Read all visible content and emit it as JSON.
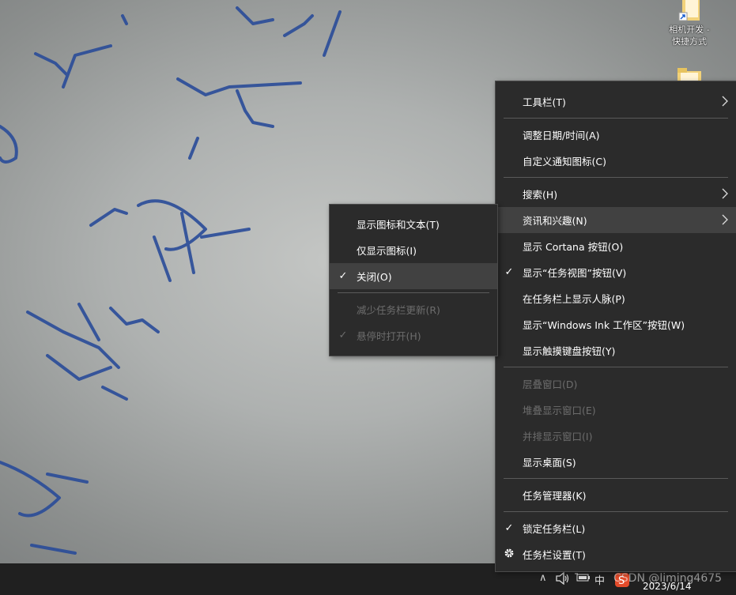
{
  "desktop": {
    "icons": [
      {
        "label_line1": "相机开发 -",
        "label_line2": "快捷方式",
        "icon": "folder-shortcut-icon"
      },
      {
        "label_line1": "",
        "label_line2": "",
        "icon": "folder-icon"
      }
    ]
  },
  "main_menu": {
    "items": [
      {
        "label": "工具栏(T)",
        "submenu": true
      },
      {
        "label": "调整日期/时间(A)"
      },
      {
        "label": "自定义通知图标(C)"
      },
      {
        "label": "搜索(H)",
        "submenu": true
      },
      {
        "label": "资讯和兴趣(N)",
        "submenu": true,
        "highlighted": true
      },
      {
        "label": "显示 Cortana 按钮(O)"
      },
      {
        "label": "显示“任务视图”按钮(V)",
        "checked": true
      },
      {
        "label": "在任务栏上显示人脉(P)"
      },
      {
        "label": "显示“Windows Ink 工作区”按钮(W)"
      },
      {
        "label": "显示触摸键盘按钮(Y)"
      },
      {
        "label": "层叠窗口(D)",
        "disabled": true
      },
      {
        "label": "堆叠显示窗口(E)",
        "disabled": true
      },
      {
        "label": "并排显示窗口(I)",
        "disabled": true
      },
      {
        "label": "显示桌面(S)"
      },
      {
        "label": "任务管理器(K)"
      },
      {
        "label": "锁定任务栏(L)",
        "checked": true
      },
      {
        "label": "任务栏设置(T)",
        "icon": "gear-icon"
      }
    ]
  },
  "sub_menu": {
    "items": [
      {
        "label": "显示图标和文本(T)"
      },
      {
        "label": "仅显示图标(I)"
      },
      {
        "label": "关闭(O)",
        "checked": true,
        "highlighted": true
      },
      {
        "label": "减少任务栏更新(R)",
        "disabled": true
      },
      {
        "label": "悬停时打开(H)",
        "checked": true,
        "disabled": true
      }
    ]
  },
  "taskbar": {
    "ime_label": "中",
    "date": "2023/6/14",
    "watermark": "CSDN @liming4675"
  },
  "glyphs": {
    "check": "✓",
    "caret_up": "∧"
  },
  "colors": {
    "menu_bg": "#2b2b2b",
    "menu_hover": "#414141",
    "disabled_text": "#6d6d6d",
    "taskbar_bg": "#202020"
  }
}
